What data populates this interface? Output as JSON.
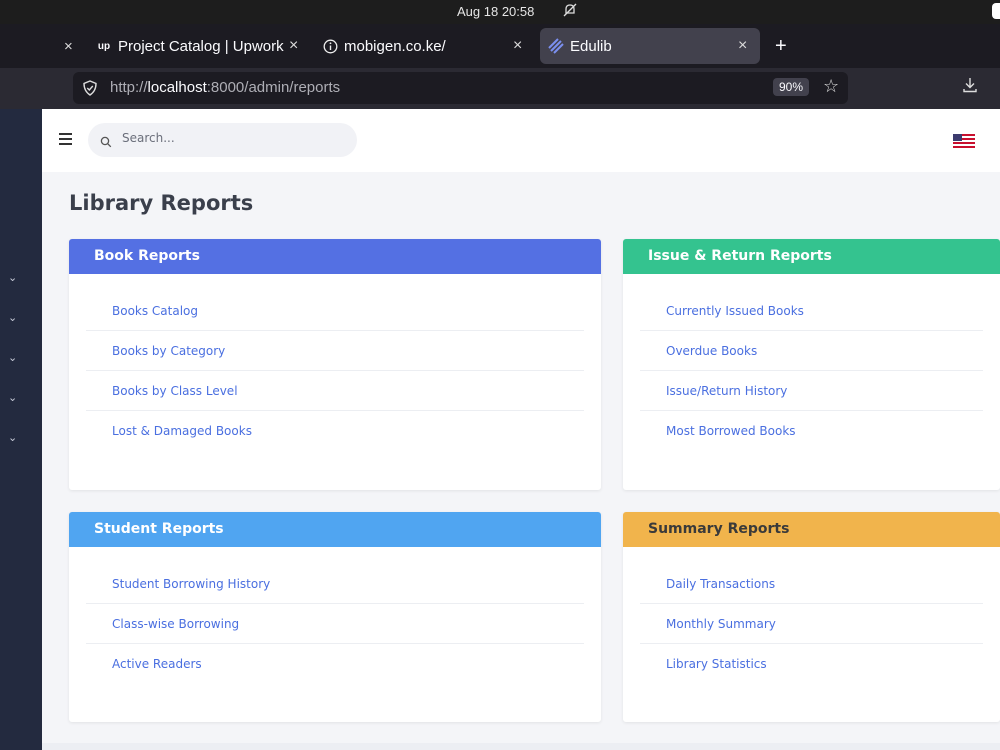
{
  "os": {
    "clock": "Aug 18  20:58",
    "bell_icon": "bell-muted-icon"
  },
  "browser": {
    "tabs": [
      {
        "label": "Project Catalog | Upwork",
        "icon": "upwork-icon",
        "active": false
      },
      {
        "label": "mobigen.co.ke/",
        "icon": "info-icon",
        "active": false
      },
      {
        "label": "Edulib",
        "icon": "edulib-icon",
        "active": true
      }
    ],
    "new_tab_label": "+",
    "url": {
      "scheme": "http://",
      "host": "localhost",
      "path": ":8000/admin/reports"
    },
    "zoom": "90%"
  },
  "header": {
    "search_placeholder": "Search..."
  },
  "page": {
    "title": "Library Reports"
  },
  "colors": {
    "book_reports": "#5470e3",
    "issue_return_reports": "#34c38f",
    "student_reports": "#50a5f1",
    "summary_reports": "#f1b44c"
  },
  "cards": {
    "book": {
      "title": "Book Reports",
      "items": [
        "Books Catalog",
        "Books by Category",
        "Books by Class Level",
        "Lost & Damaged Books"
      ]
    },
    "issue": {
      "title": "Issue & Return Reports",
      "items": [
        "Currently Issued Books",
        "Overdue Books",
        "Issue/Return History",
        "Most Borrowed Books"
      ]
    },
    "student": {
      "title": "Student Reports",
      "items": [
        "Student Borrowing History",
        "Class-wise Borrowing",
        "Active Readers"
      ]
    },
    "summary": {
      "title": "Summary Reports",
      "items": [
        "Daily Transactions",
        "Monthly Summary",
        "Library Statistics"
      ]
    }
  }
}
